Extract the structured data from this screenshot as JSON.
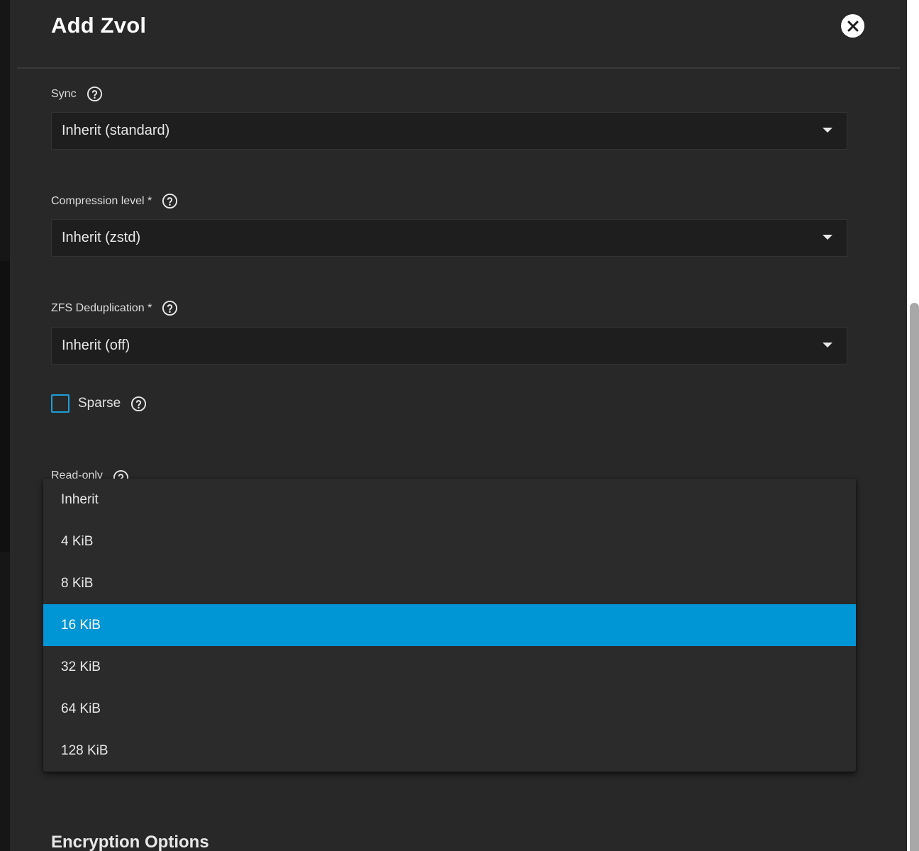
{
  "dialog": {
    "title": "Add Zvol",
    "close_icon": "close-icon"
  },
  "fields": {
    "sync": {
      "label": "Sync",
      "value": "Inherit (standard)"
    },
    "compression": {
      "label": "Compression level *",
      "value": "Inherit (zstd)"
    },
    "dedup": {
      "label": "ZFS Deduplication *",
      "value": "Inherit (off)"
    },
    "sparse": {
      "label": "Sparse",
      "checked": false
    },
    "readonly": {
      "label": "Read-only"
    }
  },
  "dropdown": {
    "options": [
      "Inherit",
      "4 KiB",
      "8 KiB",
      "16 KiB",
      "32 KiB",
      "64 KiB",
      "128 KiB"
    ],
    "selected": "16 KiB"
  },
  "sections": {
    "encryption": "Encryption Options"
  },
  "colors": {
    "accent": "#0095d5",
    "checkbox_border": "#1e9ed8",
    "panel_bg": "#282828",
    "select_bg": "#1e1e1e"
  }
}
